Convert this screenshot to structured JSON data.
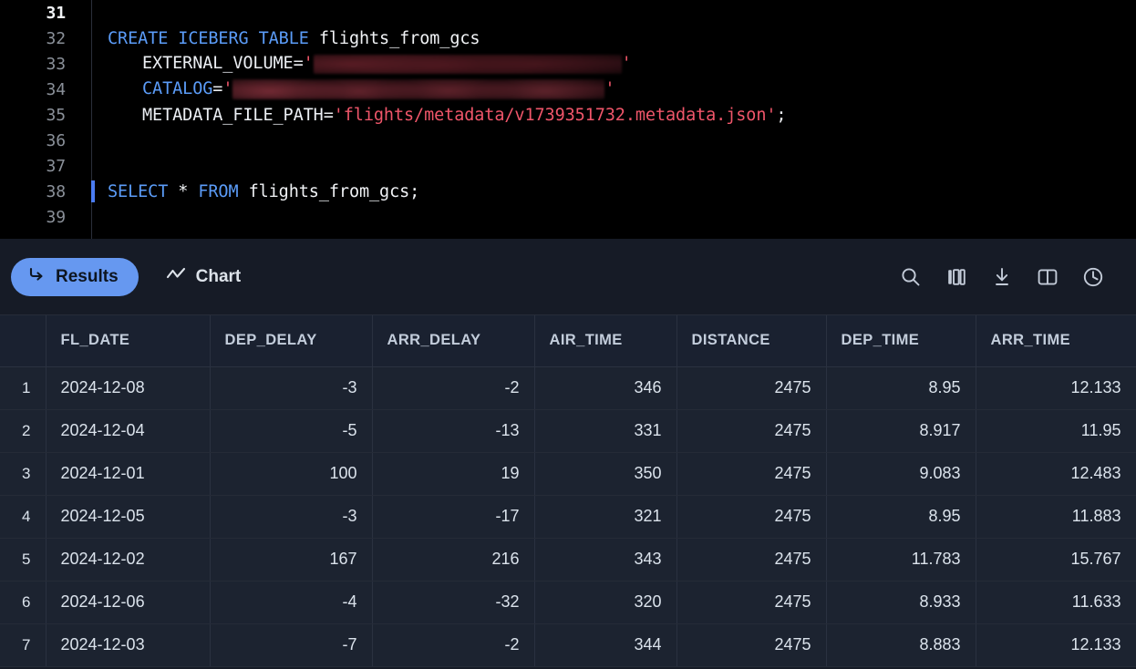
{
  "editor": {
    "lines": [
      {
        "n": "31",
        "active": true,
        "tokens": []
      },
      {
        "n": "32",
        "active": false,
        "tokens": [
          {
            "t": "CREATE ",
            "c": "kw"
          },
          {
            "t": "ICEBERG ",
            "c": "kw"
          },
          {
            "t": "TABLE ",
            "c": "kw"
          },
          {
            "t": "flights_from_gcs",
            "c": "plain"
          }
        ]
      },
      {
        "n": "33",
        "active": false,
        "indent": 1,
        "tokens": [
          {
            "t": "EXTERNAL_VOLUME",
            "c": "prop"
          },
          {
            "t": "=",
            "c": "punct"
          },
          {
            "t": "'",
            "c": "str"
          },
          {
            "t": "",
            "c": "redact-a"
          },
          {
            "t": "'",
            "c": "str"
          }
        ]
      },
      {
        "n": "34",
        "active": false,
        "indent": 1,
        "tokens": [
          {
            "t": "CATALOG",
            "c": "prop-blue"
          },
          {
            "t": "=",
            "c": "punct"
          },
          {
            "t": "'",
            "c": "str"
          },
          {
            "t": "",
            "c": "redact-b"
          },
          {
            "t": "'",
            "c": "str"
          }
        ]
      },
      {
        "n": "35",
        "active": false,
        "indent": 1,
        "tokens": [
          {
            "t": "METADATA_FILE_PATH",
            "c": "prop"
          },
          {
            "t": "=",
            "c": "punct"
          },
          {
            "t": "'flights/metadata/v1739351732.metadata.json'",
            "c": "str"
          },
          {
            "t": ";",
            "c": "punct"
          }
        ]
      },
      {
        "n": "36",
        "active": false,
        "tokens": []
      },
      {
        "n": "37",
        "active": false,
        "tokens": []
      },
      {
        "n": "38",
        "active": false,
        "cursor": true,
        "tokens": [
          {
            "t": "SELECT ",
            "c": "kw"
          },
          {
            "t": "* ",
            "c": "plain"
          },
          {
            "t": "FROM ",
            "c": "kw"
          },
          {
            "t": "flights_from_gcs;",
            "c": "plain"
          }
        ]
      },
      {
        "n": "39",
        "active": false,
        "tokens": []
      }
    ]
  },
  "toolbar": {
    "results_label": "Results",
    "chart_label": "Chart",
    "results_icon": "arrow-return-icon",
    "chart_icon": "line-chart-icon",
    "actions": [
      {
        "name": "search-icon",
        "title": "Search"
      },
      {
        "name": "columns-icon",
        "title": "Columns"
      },
      {
        "name": "download-icon",
        "title": "Download"
      },
      {
        "name": "split-panel-icon",
        "title": "Split panel"
      },
      {
        "name": "history-clock-icon",
        "title": "History"
      }
    ],
    "accent_color": "#6698f0"
  },
  "results": {
    "columns": [
      "FL_DATE",
      "DEP_DELAY",
      "ARR_DELAY",
      "AIR_TIME",
      "DISTANCE",
      "DEP_TIME",
      "ARR_TIME"
    ],
    "rows": [
      {
        "n": "1",
        "cells": [
          "2024-12-08",
          "-3",
          "-2",
          "346",
          "2475",
          "8.95",
          "12.133"
        ]
      },
      {
        "n": "2",
        "cells": [
          "2024-12-04",
          "-5",
          "-13",
          "331",
          "2475",
          "8.917",
          "11.95"
        ]
      },
      {
        "n": "3",
        "cells": [
          "2024-12-01",
          "100",
          "19",
          "350",
          "2475",
          "9.083",
          "12.483"
        ]
      },
      {
        "n": "4",
        "cells": [
          "2024-12-05",
          "-3",
          "-17",
          "321",
          "2475",
          "8.95",
          "11.883"
        ]
      },
      {
        "n": "5",
        "cells": [
          "2024-12-02",
          "167",
          "216",
          "343",
          "2475",
          "11.783",
          "15.767"
        ]
      },
      {
        "n": "6",
        "cells": [
          "2024-12-06",
          "-4",
          "-32",
          "320",
          "2475",
          "8.933",
          "11.633"
        ]
      },
      {
        "n": "7",
        "cells": [
          "2024-12-03",
          "-7",
          "-2",
          "344",
          "2475",
          "8.883",
          "12.133"
        ]
      }
    ]
  }
}
